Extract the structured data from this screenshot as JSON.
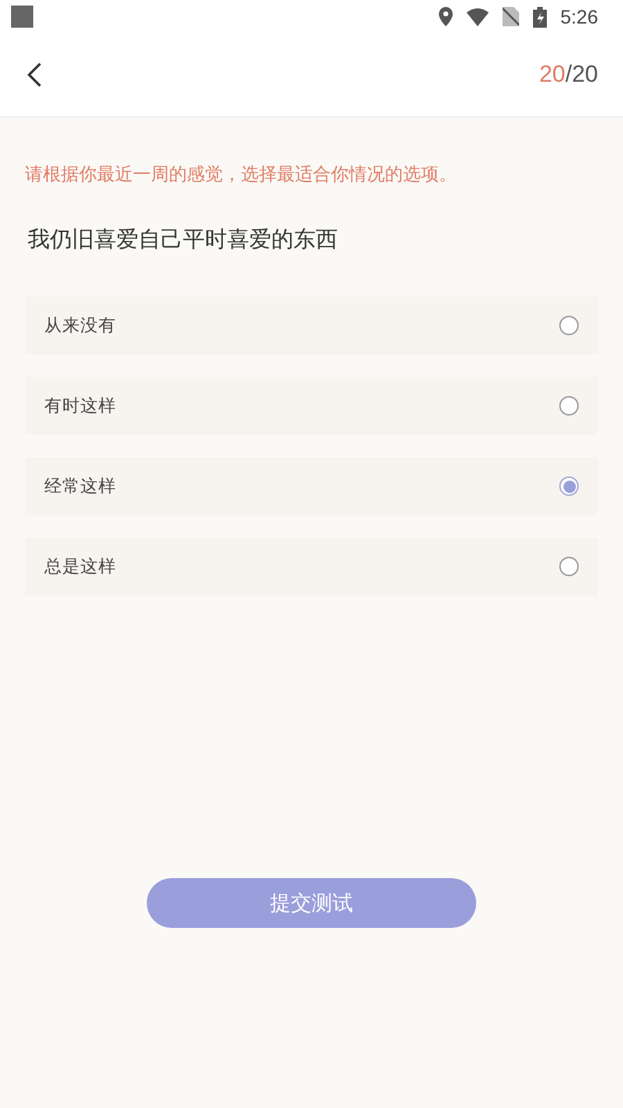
{
  "status_bar": {
    "time": "5:26"
  },
  "header": {
    "progress_current": "20",
    "progress_total": "/20"
  },
  "instruction": "请根据你最近一周的感觉，选择最适合你情况的选项。",
  "question": "我仍旧喜爱自己平时喜爱的东西",
  "options": [
    {
      "label": "从来没有",
      "selected": false
    },
    {
      "label": "有时这样",
      "selected": false
    },
    {
      "label": "经常这样",
      "selected": true
    },
    {
      "label": "总是这样",
      "selected": false
    }
  ],
  "submit_button": {
    "label": "提交测试"
  }
}
